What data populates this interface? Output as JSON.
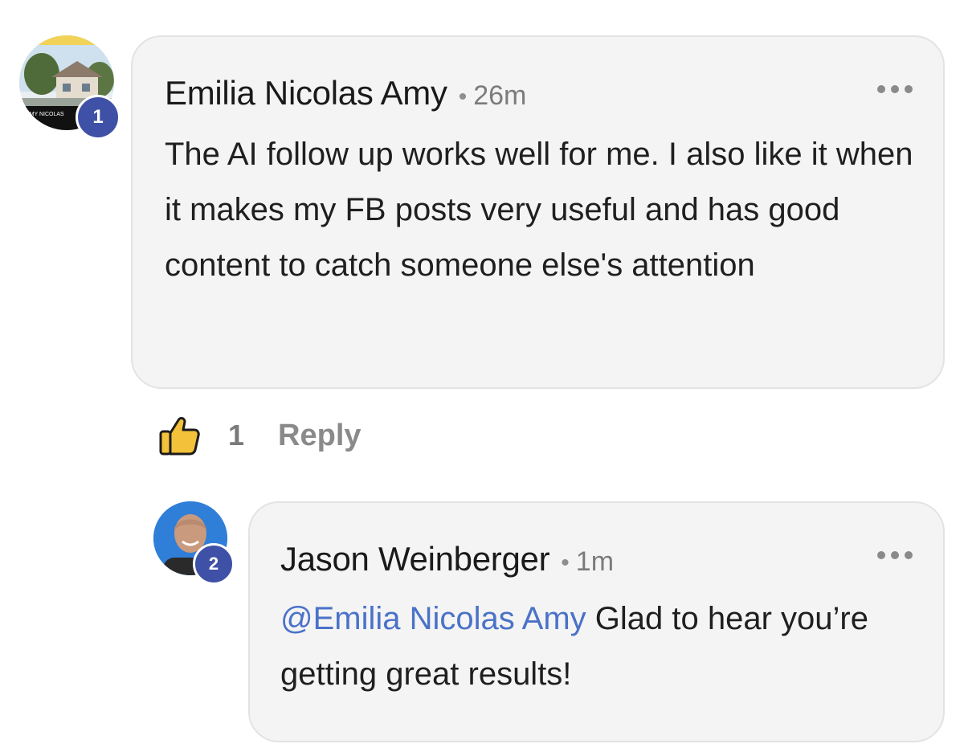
{
  "comments": [
    {
      "author": "Emilia Nicolas Amy",
      "separator": "•",
      "time": "26m",
      "level": "1",
      "avatar_text": "AMY NICOLAS",
      "body": "The AI follow up works well for me. I also like it when it makes my FB posts very useful and has good content to catch someone else's attention",
      "likes": "1",
      "reply_label": "Reply"
    },
    {
      "author": "Jason Weinberger",
      "separator": "•",
      "time": "1m",
      "level": "2",
      "mention": "@Emilia Nicolas Amy",
      "body": " Glad to hear you’re getting great results!"
    }
  ],
  "icons": {
    "more": "more-horizontal-icon",
    "like": "thumbs-up-icon"
  },
  "colors": {
    "bubble_bg": "#f4f4f4",
    "bubble_border": "#e3e3e3",
    "badge": "#3f51a6",
    "mention": "#4a72c8",
    "like_yellow": "#f3c13a",
    "muted": "#8a8a8a"
  }
}
